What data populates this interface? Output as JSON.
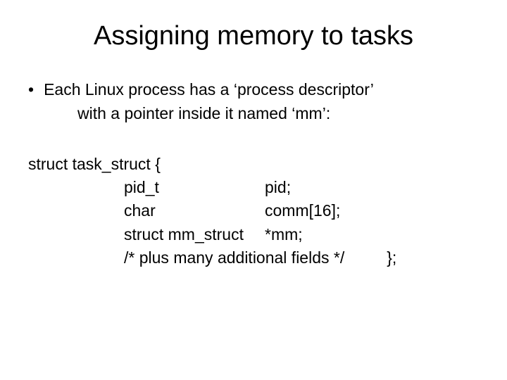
{
  "title": "Assigning memory to tasks",
  "bullet": {
    "line1": "Each Linux process has a ‘process descriptor’",
    "line2": "with a pointer inside it named ‘mm’:"
  },
  "code": {
    "open": "struct task_struct {",
    "rows": [
      {
        "type": "pid_t",
        "name": "pid;"
      },
      {
        "type": "char",
        "name": "comm[16];"
      },
      {
        "type": "struct mm_struct",
        "name": "*mm;"
      }
    ],
    "comment": "/* plus many additional fields */",
    "close": "};"
  }
}
